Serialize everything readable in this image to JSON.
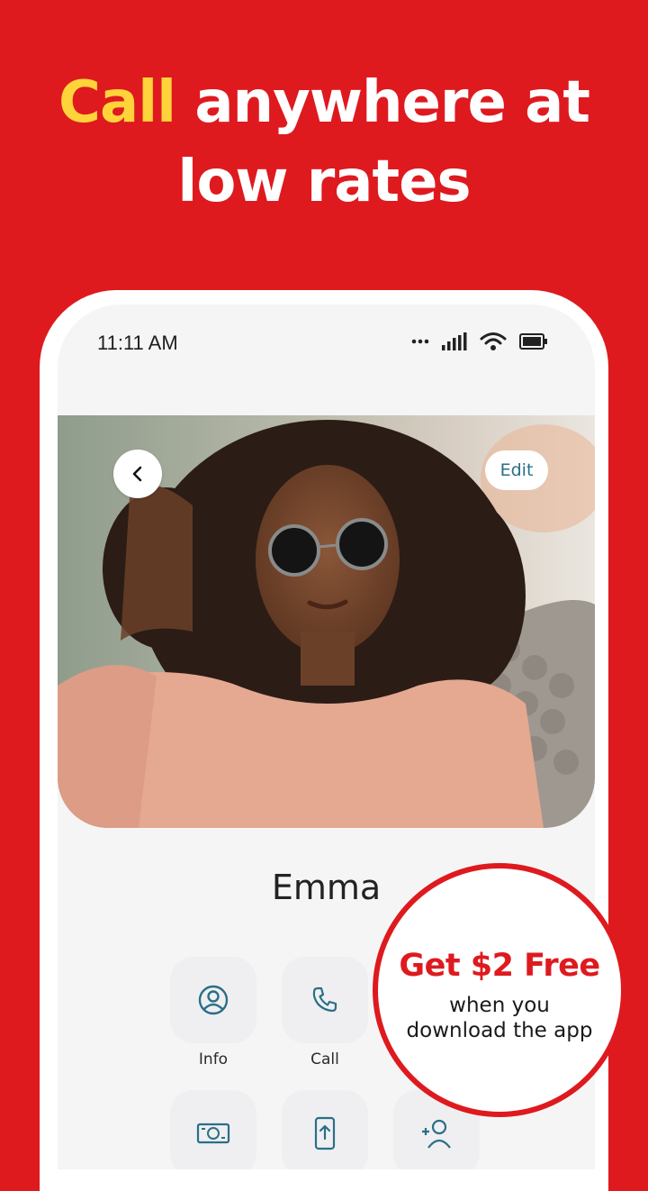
{
  "headline": {
    "highlight": "Call",
    "rest_line1": " anywhere at",
    "line2": "low rates"
  },
  "status_bar": {
    "time": "11:11 AM",
    "icons": [
      "more-dots-icon",
      "signal-icon",
      "wifi-icon",
      "battery-icon"
    ]
  },
  "contact": {
    "back_icon": "chevron-left-icon",
    "edit_label": "Edit",
    "name": "Emma"
  },
  "actions": [
    {
      "label": "Info",
      "icon": "person-circle-icon"
    },
    {
      "label": "Call",
      "icon": "phone-icon"
    }
  ],
  "actions_row2": [
    {
      "icon": "money-icon"
    },
    {
      "icon": "mobile-upload-icon"
    },
    {
      "icon": "add-contact-icon"
    }
  ],
  "promo": {
    "title": "Get $2 Free",
    "line1": "when you",
    "line2": "download the app"
  },
  "colors": {
    "background": "#de1a1f",
    "highlight": "#ffd43b",
    "accent": "#2a6f87"
  }
}
